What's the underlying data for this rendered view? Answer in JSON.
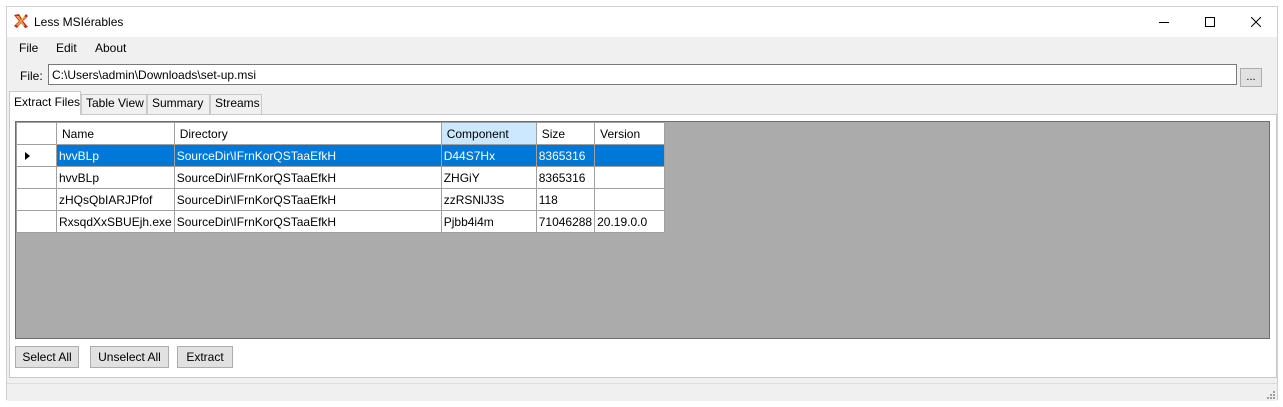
{
  "window": {
    "title": "Less MSIérables",
    "icon": "less-msierables-app-icon"
  },
  "menu": {
    "file": "File",
    "edit": "Edit",
    "about": "About"
  },
  "file_row": {
    "label": "File:",
    "path": "C:\\Users\\admin\\Downloads\\set-up.msi",
    "browse_label": "..."
  },
  "tabs": {
    "extract_files": "Extract Files",
    "table_view": "Table View",
    "summary": "Summary",
    "streams": "Streams",
    "active": "Extract Files"
  },
  "grid": {
    "columns": {
      "name": "Name",
      "directory": "Directory",
      "component": "Component",
      "size": "Size",
      "version": "Version"
    },
    "sorted_column": "Component",
    "rows": [
      {
        "name": "hvvBLp",
        "directory": "SourceDir\\IFrnKorQSTaaEfkH",
        "component": "D44S7Hx",
        "size": "8365316",
        "version": ""
      },
      {
        "name": "hvvBLp",
        "directory": "SourceDir\\IFrnKorQSTaaEfkH",
        "component": "ZHGiY",
        "size": "8365316",
        "version": ""
      },
      {
        "name": "zHQsQbIARJPfof",
        "directory": "SourceDir\\IFrnKorQSTaaEfkH",
        "component": "zzRSNlJ3S",
        "size": "118",
        "version": ""
      },
      {
        "name": "RxsqdXxSBUEjh.exe",
        "directory": "SourceDir\\IFrnKorQSTaaEfkH",
        "component": "Pjbb4i4m",
        "size": "71046288",
        "version": "20.19.0.0"
      }
    ],
    "selected_row_index": 0
  },
  "buttons": {
    "select_all": "Select All",
    "unselect_all": "Unselect All",
    "extract": "Extract"
  },
  "colors": {
    "selection": "#0078d7",
    "sorted_header": "#cce8ff",
    "grid_background": "#ababab"
  }
}
